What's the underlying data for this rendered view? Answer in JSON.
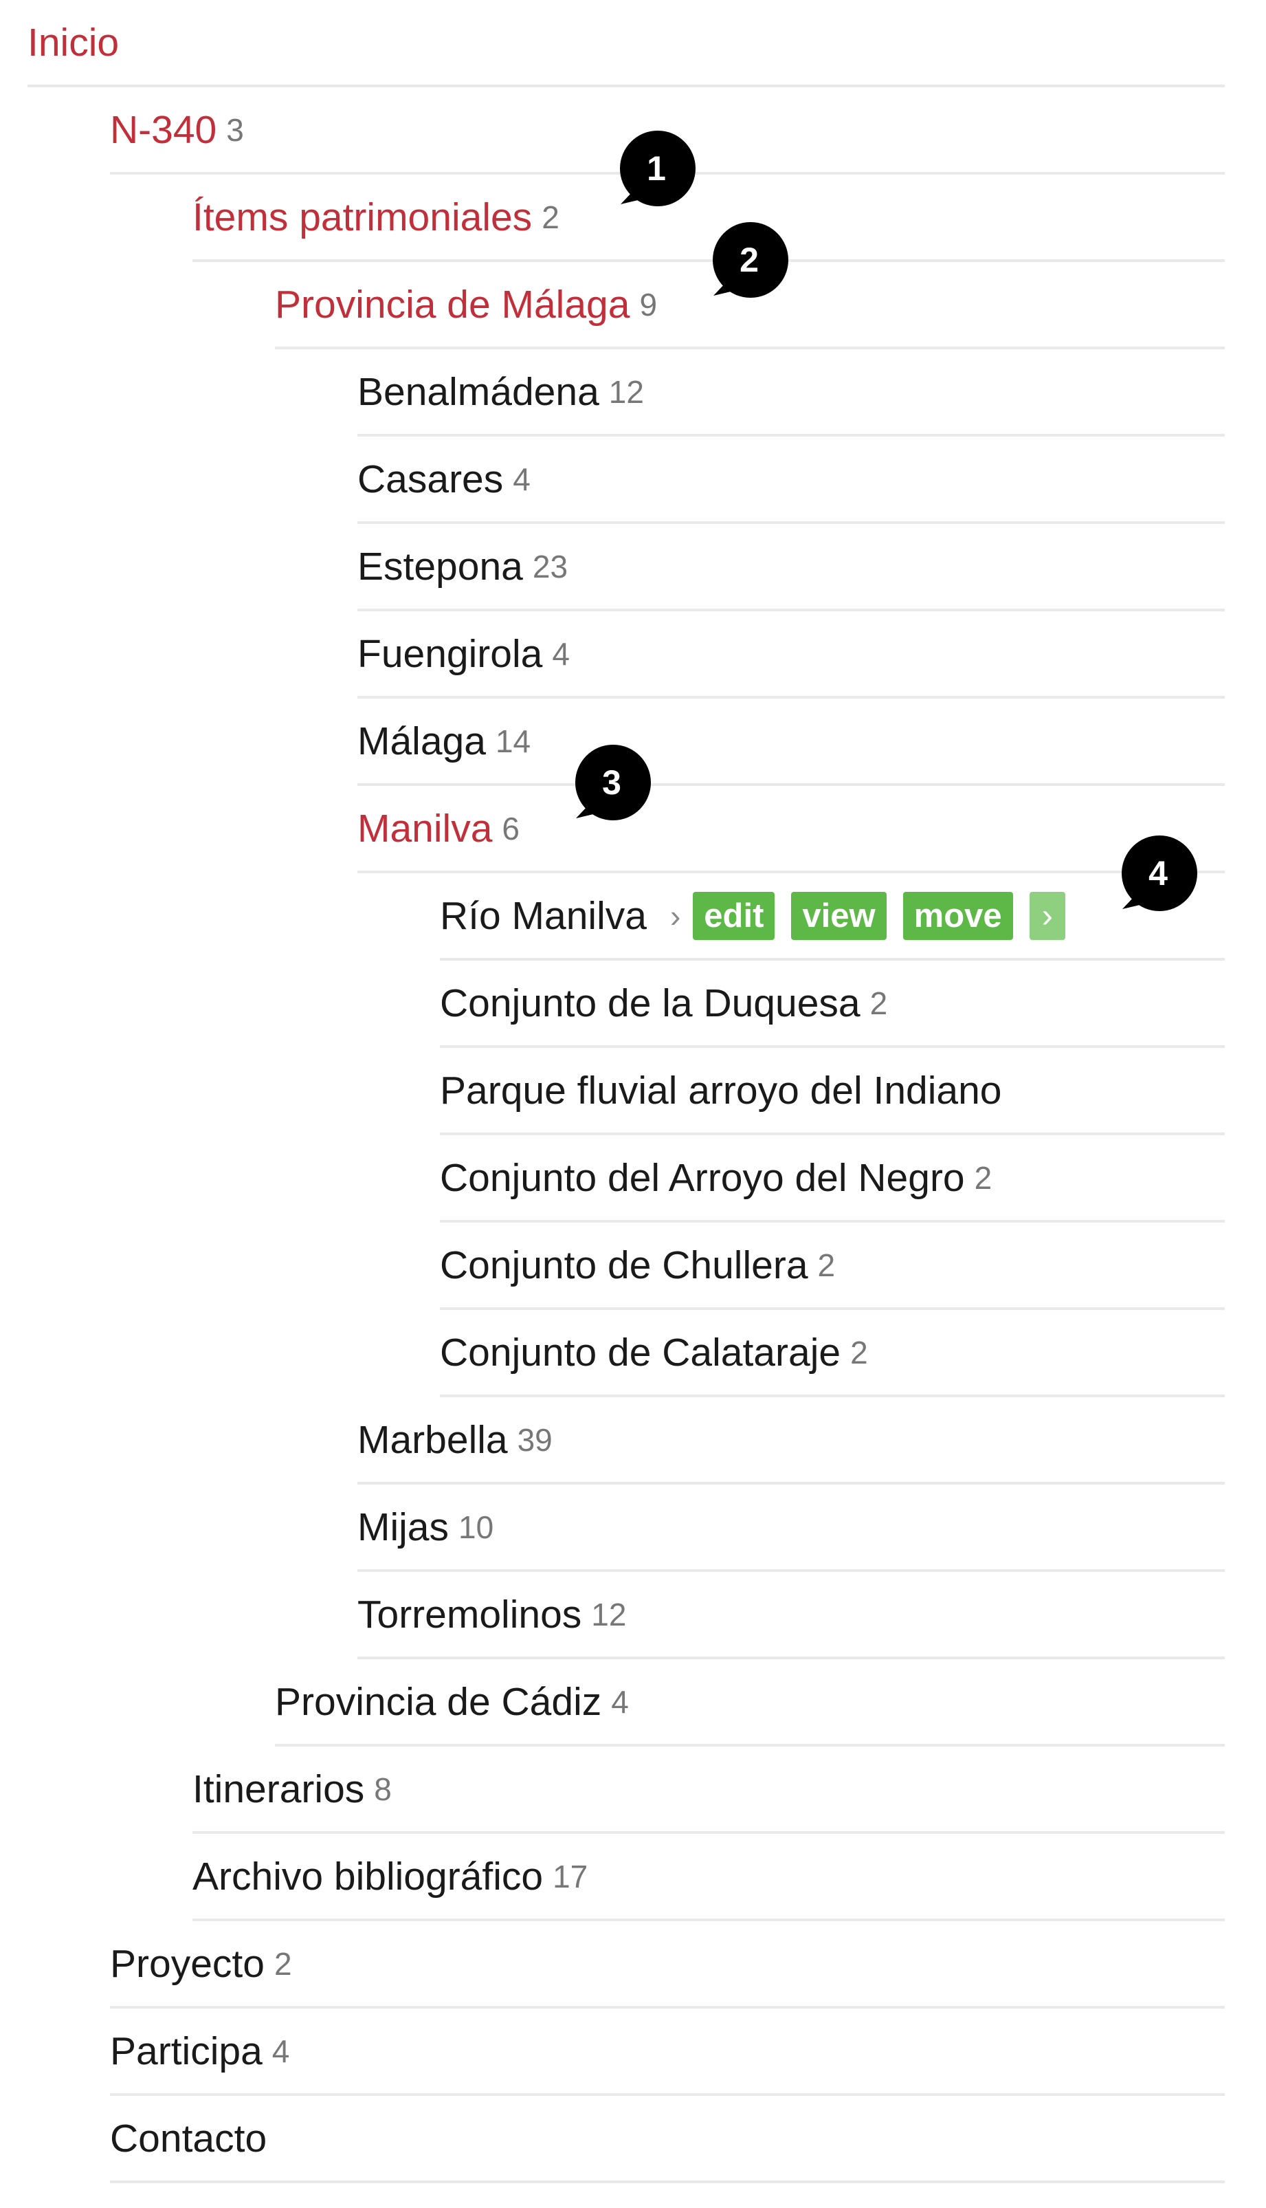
{
  "tree": [
    {
      "label": "Inicio",
      "count": "",
      "highlight": true
    },
    {
      "label": "N-340",
      "count": "3",
      "highlight": true
    },
    {
      "label": "Ítems patrimoniales",
      "count": "2",
      "highlight": true
    },
    {
      "label": "Provincia de Málaga",
      "count": "9",
      "highlight": true
    },
    {
      "label": "Benalmádena",
      "count": "12",
      "highlight": false
    },
    {
      "label": "Casares",
      "count": "4",
      "highlight": false
    },
    {
      "label": "Estepona",
      "count": "23",
      "highlight": false
    },
    {
      "label": "Fuengirola",
      "count": "4",
      "highlight": false
    },
    {
      "label": "Málaga",
      "count": "14",
      "highlight": false
    },
    {
      "label": "Manilva",
      "count": "6",
      "highlight": true
    },
    {
      "label": "Río Manilva",
      "count": "",
      "highlight": false,
      "actions": {
        "chevron": "›",
        "edit": "edit",
        "view": "view",
        "move": "move",
        "more": "›"
      }
    },
    {
      "label": "Conjunto de la Duquesa",
      "count": "2",
      "highlight": false
    },
    {
      "label": "Parque fluvial arroyo del Indiano",
      "count": "",
      "highlight": false
    },
    {
      "label": "Conjunto del Arroyo del Negro",
      "count": "2",
      "highlight": false
    },
    {
      "label": "Conjunto de Chullera",
      "count": "2",
      "highlight": false
    },
    {
      "label": "Conjunto de Calataraje",
      "count": "2",
      "highlight": false
    },
    {
      "label": "Marbella",
      "count": "39",
      "highlight": false
    },
    {
      "label": "Mijas",
      "count": "10",
      "highlight": false
    },
    {
      "label": "Torremolinos",
      "count": "12",
      "highlight": false
    },
    {
      "label": "Provincia de Cádiz",
      "count": "4",
      "highlight": false
    },
    {
      "label": "Itinerarios",
      "count": "8",
      "highlight": false
    },
    {
      "label": "Archivo bibliográfico",
      "count": "17",
      "highlight": false
    },
    {
      "label": "Proyecto",
      "count": "2",
      "highlight": false
    },
    {
      "label": "Participa",
      "count": "4",
      "highlight": false
    },
    {
      "label": "Contacto",
      "count": "",
      "highlight": false
    }
  ],
  "callouts": [
    "1",
    "2",
    "3",
    "4"
  ],
  "colors": {
    "active_link": "#c1303a",
    "text": "#1a1a1a",
    "count": "#777777",
    "action_button": "#5db848",
    "action_button_light": "#8fd080",
    "callout": "#000000"
  }
}
